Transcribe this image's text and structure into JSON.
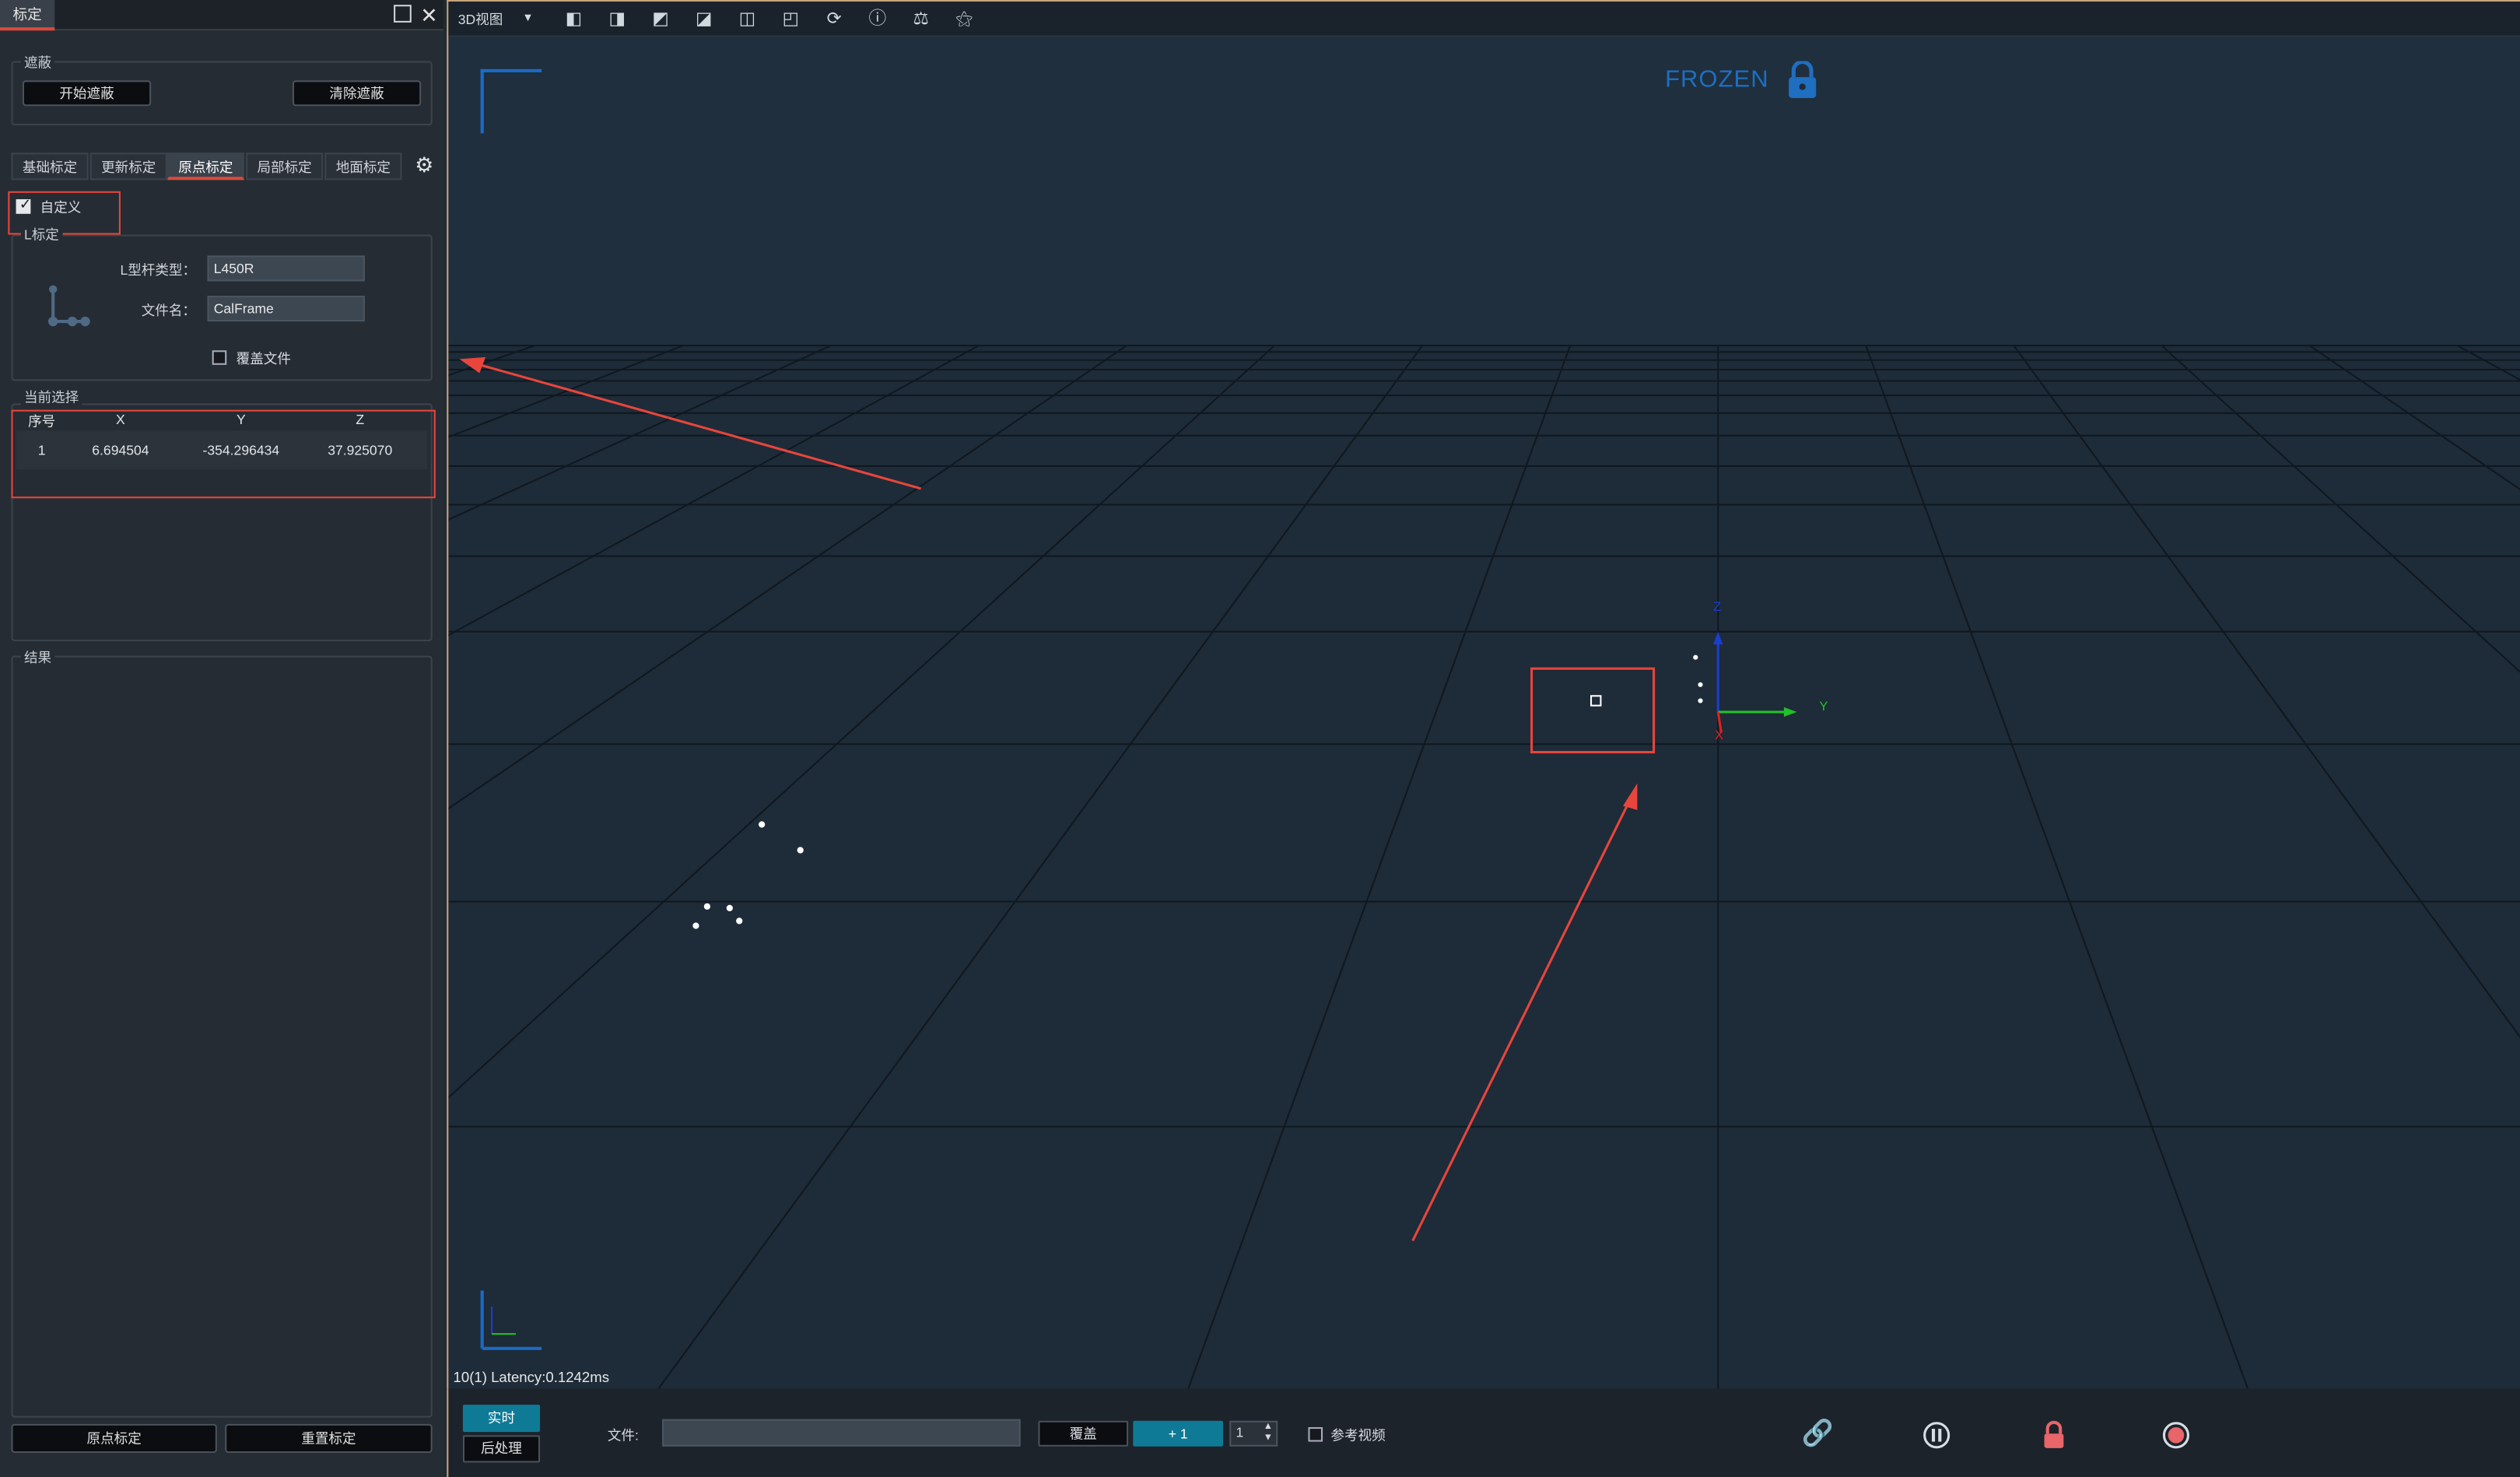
{
  "panel": {
    "tab_title": "标定",
    "mask": {
      "group_label": "遮蔽",
      "start_btn": "开始遮蔽",
      "clear_btn": "清除遮蔽"
    },
    "tabs": [
      "基础标定",
      "更新标定",
      "原点标定",
      "局部标定",
      "地面标定"
    ],
    "active_tab": 2,
    "custom_label": "自定义",
    "custom_checked": true,
    "l_group_label": "L标定",
    "l_type_label": "L型杆类型：",
    "l_type_value": "L450R",
    "filename_label": "文件名：",
    "filename_value": "CalFrame",
    "overwrite_label": "覆盖文件",
    "overwrite_checked": false,
    "selection_label": "当前选择",
    "table": {
      "headers": [
        "序号",
        "X",
        "Y",
        "Z"
      ],
      "rows": [
        [
          "1",
          "6.694504",
          "-354.296434",
          "37.925070"
        ]
      ]
    },
    "result_label": "结果",
    "origin_btn": "原点标定",
    "reset_btn": "重置标定"
  },
  "viewport": {
    "view_select": "3D视图",
    "frozen_text": "FROZEN",
    "latency_text": "10(1) Latency:0.1242ms",
    "axis_labels": {
      "x": "X",
      "y": "Y",
      "z": "Z"
    },
    "toolbar_icons": [
      "view-front-icon",
      "view-back-icon",
      "view-left-icon",
      "view-right-icon",
      "view-top-icon",
      "view-bottom-icon",
      "refresh-icon",
      "info-icon",
      "rigid-body-icon",
      "marker-icon"
    ]
  },
  "bottom": {
    "realtime_btn": "实时",
    "post_btn": "后处理",
    "file_label": "文件:",
    "file_value": "",
    "cover_btn": "覆盖",
    "plus_btn": "+ 1",
    "spin_value": "1",
    "ref_video_label": "参考视频",
    "ref_video_checked": false
  },
  "colors": {
    "accent": "#0e7a96",
    "annotation": "#e8453c",
    "frozen": "#1f6ec0",
    "grid": "#0f1820",
    "viewport_bg": "#1e2b38"
  }
}
